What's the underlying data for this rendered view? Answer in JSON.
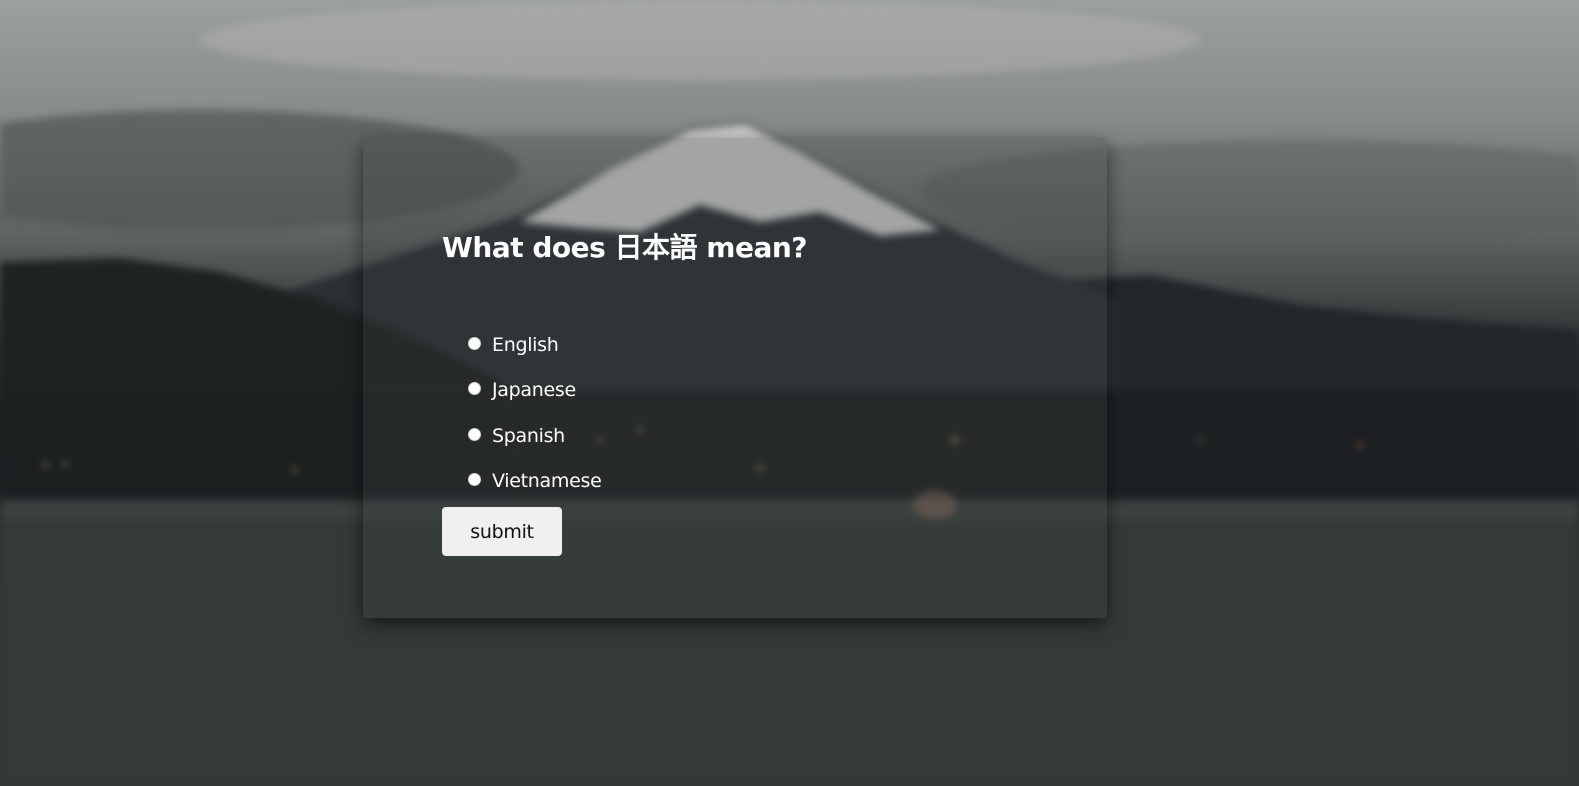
{
  "quiz": {
    "question": "What does 日本語 mean?",
    "options": [
      {
        "label": "English",
        "selected": false
      },
      {
        "label": "Japanese",
        "selected": false
      },
      {
        "label": "Spanish",
        "selected": false
      },
      {
        "label": "Vietnamese",
        "selected": false
      }
    ],
    "submit_label": "submit"
  },
  "colors": {
    "text": "#ffffff",
    "button_bg": "#f0f0f0",
    "button_text": "#111111"
  }
}
